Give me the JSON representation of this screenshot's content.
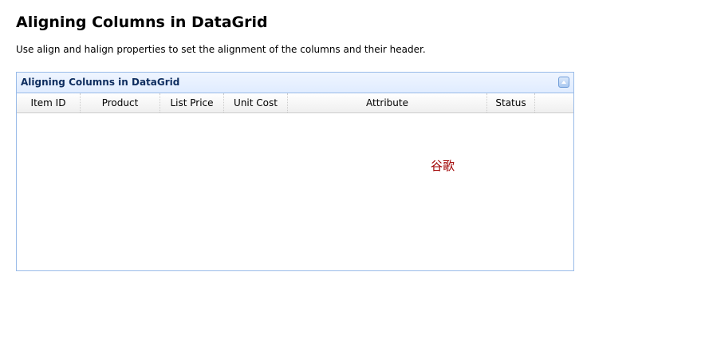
{
  "page": {
    "title": "Aligning Columns in DataGrid",
    "description": "Use align and halign properties to set the alignment of the columns and their header."
  },
  "panel": {
    "title": "Aligning Columns in DataGrid",
    "collapse_icon": "chevron-up-icon"
  },
  "grid": {
    "columns": [
      {
        "label": "Item ID"
      },
      {
        "label": "Product"
      },
      {
        "label": "List Price"
      },
      {
        "label": "Unit Cost"
      },
      {
        "label": "Attribute"
      },
      {
        "label": "Status"
      }
    ],
    "rows": []
  },
  "overlay": {
    "text": "谷歌"
  },
  "colors": {
    "panel_border": "#99bbe8",
    "panel_title": "#0e2d5f",
    "overlay_text": "#a00000"
  }
}
